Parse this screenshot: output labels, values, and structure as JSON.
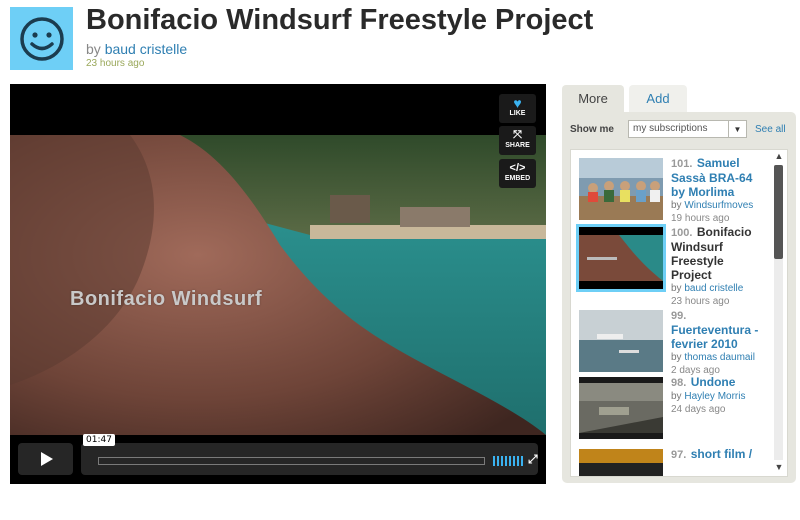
{
  "header": {
    "title": "Bonifacio Windsurf Freestyle Project",
    "by_prefix": "by",
    "author": "baud cristelle",
    "time_ago": "23 hours ago",
    "avatar_icon": "smiley-face-icon"
  },
  "player": {
    "overlay_text": "Bonifacio Windsurf",
    "buttons": [
      {
        "label": "LIKE",
        "icon": "heart-icon"
      },
      {
        "label": "SHARE",
        "icon": "share-icon"
      },
      {
        "label": "EMBED",
        "icon": "embed-icon"
      }
    ],
    "timecode": "01:47",
    "play_icon": "play-icon",
    "volume_icon": "volume-icon",
    "fullscreen_icon": "fullscreen-icon"
  },
  "panel": {
    "tabs": [
      {
        "label": "More",
        "active": true
      },
      {
        "label": "Add",
        "active": false
      }
    ],
    "show_me_label": "Show me",
    "select_value": "my subscriptions",
    "see_all": "See all",
    "items": [
      {
        "num": "101.",
        "title": "Samuel Sassà BRA-64 by Morlima",
        "by": "by",
        "author": "Windsurfmoves",
        "when": "19 hours ago",
        "selected": false
      },
      {
        "num": "100.",
        "title": "Bonifacio Windsurf Freestyle Project",
        "by": "by",
        "author": "baud cristelle",
        "when": "23 hours ago",
        "selected": true
      },
      {
        "num": "99.",
        "title": "Fuerteventura - fevrier 2010",
        "by": "by",
        "author": "thomas daumail",
        "when": "2 days ago",
        "selected": false
      },
      {
        "num": "98.",
        "title": "Undone",
        "by": "by",
        "author": "Hayley Morris",
        "when": "24 days ago",
        "selected": false
      },
      {
        "num": "97.",
        "title": "short film /",
        "by": "",
        "author": "",
        "when": "",
        "selected": false
      }
    ]
  },
  "colors": {
    "accent_blue": "#2f7fb2",
    "avatar_bg": "#6ecff6",
    "like_blue": "#3ab2f0",
    "panel_bg": "#e6e6df"
  }
}
